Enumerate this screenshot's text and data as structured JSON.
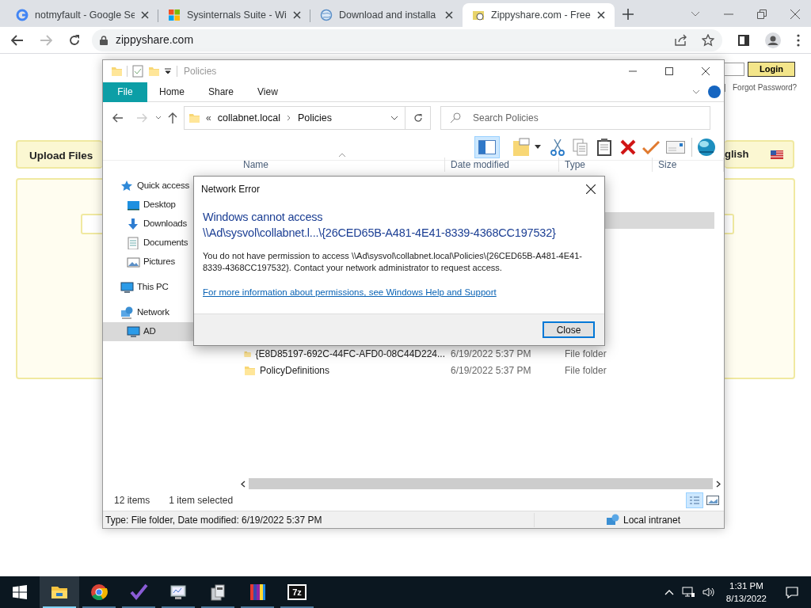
{
  "browser": {
    "tabs": [
      {
        "title": "notmyfault - Google Se",
        "selected": false,
        "kind": "google"
      },
      {
        "title": "Sysinternals Suite - Wi",
        "selected": false,
        "kind": "microsoft"
      },
      {
        "title": "Download and installa",
        "selected": false,
        "kind": "globe"
      },
      {
        "title": "Zippyshare.com - Free",
        "selected": true,
        "kind": "zippy"
      }
    ],
    "url": "zippyshare.com"
  },
  "webpage": {
    "login_button": "Login",
    "forgot_password": "Forgot Password?",
    "separator": "|",
    "upload_files": "Upload Files",
    "language": "glish"
  },
  "explorer": {
    "title": "Policies",
    "file_tab": "File",
    "ribbon_tabs": [
      "Home",
      "Share",
      "View"
    ],
    "breadcrumb_overflow": "«",
    "breadcrumb": [
      "collabnet.local",
      "Policies"
    ],
    "search": {
      "placeholder": "Search Policies"
    },
    "columns": [
      "Name",
      "Date modified",
      "Type",
      "Size"
    ],
    "nav": [
      {
        "label": "Quick access",
        "kind": "star",
        "selected": false,
        "children": [
          {
            "label": "Desktop",
            "kind": "desktop",
            "selected": false
          },
          {
            "label": "Downloads",
            "kind": "download",
            "selected": false
          },
          {
            "label": "Documents",
            "kind": "document",
            "selected": false
          },
          {
            "label": "Pictures",
            "kind": "pictures",
            "selected": false
          }
        ]
      },
      {
        "label": "This PC",
        "kind": "pc",
        "selected": false
      },
      {
        "label": "Network",
        "kind": "network",
        "selected": false,
        "children": [
          {
            "label": "AD",
            "kind": "pc",
            "selected": true
          }
        ]
      }
    ],
    "rows": [
      {
        "selected": true
      },
      {
        "name": "{E8D85197-692C-44FC-AFD0-08C44D224...",
        "date": "6/19/2022 5:37 PM",
        "type": "File folder",
        "selected": false
      },
      {
        "name": "PolicyDefinitions",
        "date": "6/19/2022 5:37 PM",
        "type": "File folder",
        "selected": false
      }
    ],
    "item_count": "12 items",
    "selection_count": "1 item selected",
    "status_text": "Type: File folder, Date modified: 6/19/2022 5:37 PM",
    "zone": "Local intranet"
  },
  "dialog": {
    "title": "Network Error",
    "heading_lines": [
      "Windows cannot access",
      "\\\\Ad\\sysvol\\collabnet.l...\\{26CED65B-A481-4E41-8339-4368CC197532}"
    ],
    "message": "You do not have permission to access \\\\Ad\\sysvol\\collabnet.local\\Policies\\{26CED65B-A481-4E41-8339-4368CC197532}. Contact your network administrator to request access.",
    "link": "For more information about permissions, see Windows Help and Support",
    "button": "Close"
  },
  "taskbar": {
    "apps": [
      {
        "kind": "explorer",
        "active": true
      },
      {
        "kind": "chrome",
        "active": false
      },
      {
        "kind": "check",
        "active": false
      },
      {
        "kind": "monitor",
        "active": false
      },
      {
        "kind": "tool",
        "active": false
      },
      {
        "kind": "bars",
        "active": false
      },
      {
        "kind": "sevenzip",
        "active": false
      }
    ],
    "sevenzip_label": "7z",
    "time": "1:31 PM",
    "date": "8/13/2022"
  }
}
